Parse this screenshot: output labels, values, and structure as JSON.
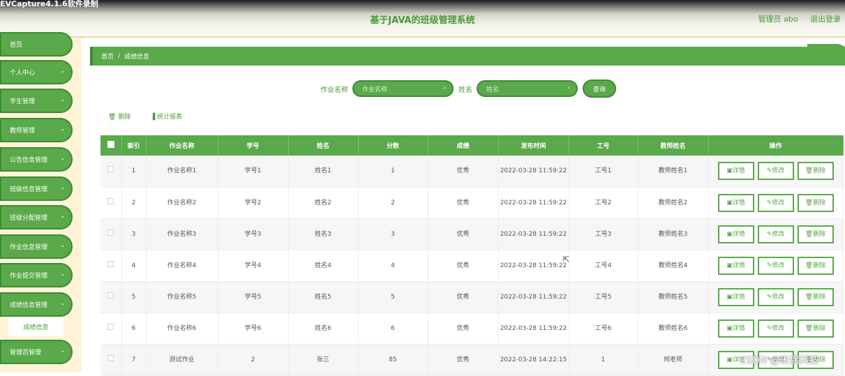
{
  "recorder_title": "EVCapture4.1.6软件录制",
  "header": {
    "title": "基于JAVA的班级管理系统",
    "user": "管理员 abo",
    "logout": "退出登录"
  },
  "sidebar": {
    "items": [
      {
        "label": "首页",
        "has_chevron": false
      },
      {
        "label": "个人中心",
        "has_chevron": true
      },
      {
        "label": "学生管理",
        "has_chevron": true
      },
      {
        "label": "教师管理",
        "has_chevron": true
      },
      {
        "label": "公告信息管理",
        "has_chevron": true
      },
      {
        "label": "班级信息管理",
        "has_chevron": true
      },
      {
        "label": "班级分配管理",
        "has_chevron": true
      },
      {
        "label": "作业信息管理",
        "has_chevron": true
      },
      {
        "label": "作业提交管理",
        "has_chevron": true
      },
      {
        "label": "成绩信息管理",
        "has_chevron": true
      },
      {
        "label": "管理员管理",
        "has_chevron": true
      }
    ],
    "sub_item": "成绩信息"
  },
  "breadcrumb": {
    "home": "首页",
    "separator": "/",
    "current": "成绩信息"
  },
  "search": {
    "homework_label": "作业名称",
    "homework_placeholder": "作业名称",
    "name_label": "姓名",
    "name_placeholder": "姓名",
    "query_button": "查询"
  },
  "toolbar": {
    "delete": "删除",
    "report": "统计报表"
  },
  "table": {
    "headers": [
      "",
      "索引",
      "作业名称",
      "学号",
      "姓名",
      "分数",
      "成绩",
      "发布时间",
      "工号",
      "教师姓名",
      "操作"
    ],
    "rows": [
      [
        "1",
        "作业名称1",
        "学号1",
        "姓名1",
        "1",
        "优秀",
        "2022-03-28 11:59:22",
        "工号1",
        "教师姓名1"
      ],
      [
        "2",
        "作业名称2",
        "学号2",
        "姓名2",
        "2",
        "优秀",
        "2022-03-28 11:59:22",
        "工号2",
        "教师姓名2"
      ],
      [
        "3",
        "作业名称3",
        "学号3",
        "姓名3",
        "3",
        "优秀",
        "2022-03-28 11:59:22",
        "工号3",
        "教师姓名3"
      ],
      [
        "4",
        "作业名称4",
        "学号4",
        "姓名4",
        "4",
        "优秀",
        "2022-03-28 11:59:22",
        "工号4",
        "教师姓名4"
      ],
      [
        "5",
        "作业名称5",
        "学号5",
        "姓名5",
        "5",
        "优秀",
        "2022-03-28 11:59:22",
        "工号5",
        "教师姓名5"
      ],
      [
        "6",
        "作业名称6",
        "学号6",
        "姓名6",
        "6",
        "优秀",
        "2022-03-28 11:59:22",
        "工号6",
        "教师姓名6"
      ],
      [
        "7",
        "测试作业",
        "2",
        "张三",
        "85",
        "优秀",
        "2022-03-28 14:22:15",
        "1",
        "何老师"
      ]
    ],
    "actions": [
      "详情",
      "修改",
      "删除"
    ]
  },
  "watermark": "CSDN @米偶科技",
  "colors": {
    "accent": "#5aa94a",
    "accent_dark": "#3f8b34",
    "sidebar_bg": "#fff3d8"
  }
}
